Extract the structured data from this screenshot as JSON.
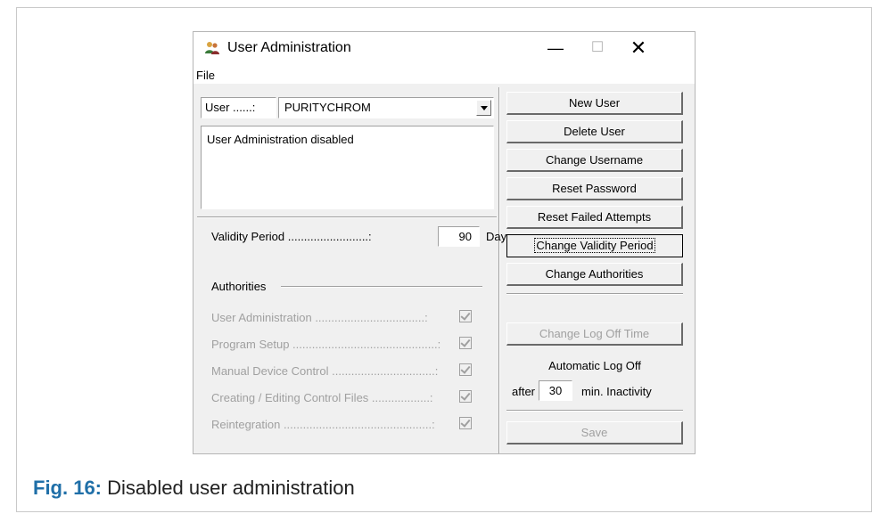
{
  "window": {
    "title": "User Administration",
    "menu": {
      "file": "File"
    },
    "controls": {
      "minimize": "—",
      "maximize": "☐",
      "close": "✕"
    }
  },
  "user": {
    "label": "User ......:",
    "selected": "PURITYCHROM",
    "status_text": "User Administration disabled"
  },
  "validity": {
    "label": "Validity Period .........................:",
    "value": "90",
    "unit": "Days"
  },
  "authorities": {
    "title": "Authorities",
    "items": [
      {
        "label": "User Administration ..................................:",
        "checked": true,
        "enabled": false
      },
      {
        "label": "Program Setup .............................................:",
        "checked": true,
        "enabled": false
      },
      {
        "label": "Manual Device Control ................................:",
        "checked": true,
        "enabled": false
      },
      {
        "label": "Creating / Editing Control Files ..................:",
        "checked": true,
        "enabled": false
      },
      {
        "label": "Reintegration ..............................................:",
        "checked": true,
        "enabled": false
      }
    ]
  },
  "buttons": {
    "new_user": "New User",
    "delete_user": "Delete User",
    "change_username": "Change Username",
    "reset_password": "Reset Password",
    "reset_failed_attempts": "Reset Failed Attempts",
    "change_validity_period": "Change Validity Period",
    "change_authorities": "Change Authorities",
    "change_log_off_time": "Change Log Off Time",
    "save": "Save"
  },
  "log_off": {
    "title": "Automatic Log Off",
    "prefix": "after",
    "value": "30",
    "suffix": "min. Inactivity"
  },
  "caption": {
    "label": "Fig. 16:",
    "text": "Disabled user administration"
  },
  "colors": {
    "caption_label": "#1f6fa8",
    "disabled_text": "#a0a0a0",
    "window_bg": "#f0f0f0"
  }
}
